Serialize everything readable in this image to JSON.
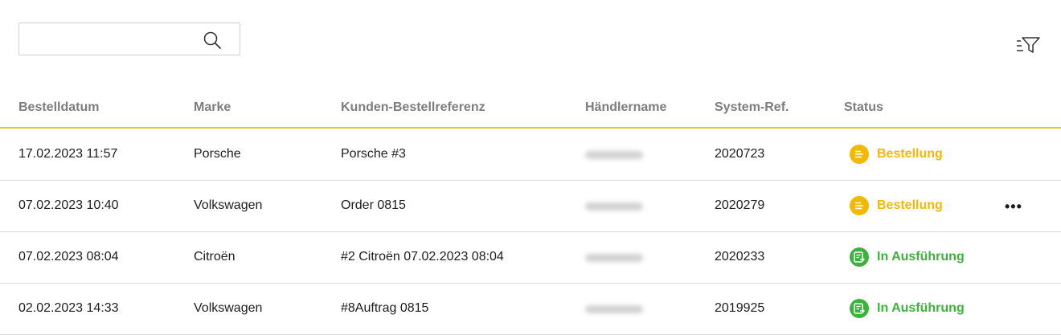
{
  "search": {
    "value": "",
    "placeholder": ""
  },
  "colors": {
    "accent": "#f5c21b",
    "status_order": "#f5b800",
    "status_progress": "#3db33d",
    "header_text": "#7d7d7d"
  },
  "table": {
    "headers": [
      "Bestelldatum",
      "Marke",
      "Kunden-Bestellreferenz",
      "Händlername",
      "System-Ref.",
      "Status"
    ],
    "rows": [
      {
        "date": "17.02.2023 11:57",
        "brand": "Porsche",
        "ref": "Porsche #3",
        "system_ref": "2020723",
        "status": "Bestellung",
        "status_type": "order"
      },
      {
        "date": "07.02.2023 10:40",
        "brand": "Volkswagen",
        "ref": "Order 0815",
        "system_ref": "2020279",
        "status": "Bestellung",
        "status_type": "order"
      },
      {
        "date": "07.02.2023 08:04",
        "brand": "Citroën",
        "ref": "#2 Citroën 07.02.2023 08:04",
        "system_ref": "2020233",
        "status": "In Ausführung",
        "status_type": "progress"
      },
      {
        "date": "02.02.2023 14:33",
        "brand": "Volkswagen",
        "ref": "#8Auftrag 0815",
        "system_ref": "2019925",
        "status": "In Ausführung",
        "status_type": "progress"
      }
    ],
    "more_label": "•••"
  }
}
